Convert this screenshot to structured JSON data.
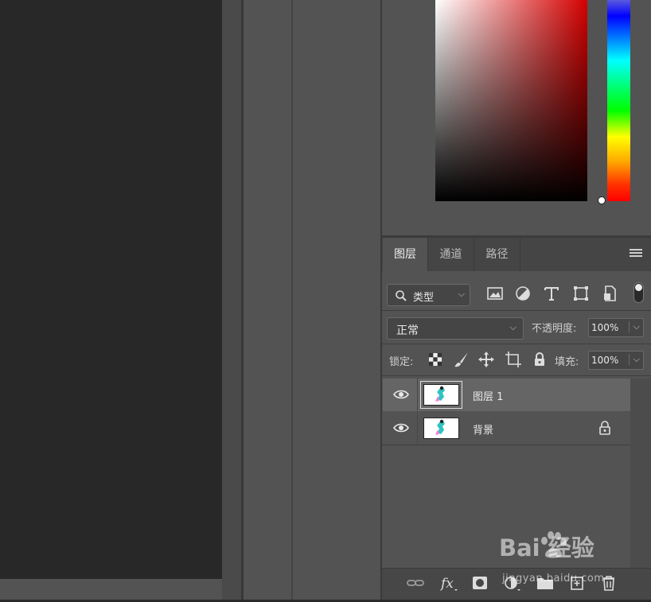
{
  "layers_panel": {
    "tabs": [
      {
        "label": "图层",
        "active": true
      },
      {
        "label": "通道",
        "active": false
      },
      {
        "label": "路径",
        "active": false
      }
    ],
    "filter": {
      "label": "类型"
    },
    "blend_mode": "正常",
    "opacity_label": "不透明度:",
    "opacity_value": "100%",
    "lock_label": "锁定:",
    "fill_label": "填充:",
    "fill_value": "100%",
    "layers": [
      {
        "name": "图层 1",
        "visible": true,
        "selected": true,
        "locked": false
      },
      {
        "name": "背景",
        "visible": true,
        "selected": false,
        "locked": true
      }
    ]
  },
  "color_picker": {
    "hue_color": "#d40000"
  },
  "watermark": {
    "brand": "Bai 经验",
    "url": "jingyan.baidu.com"
  }
}
